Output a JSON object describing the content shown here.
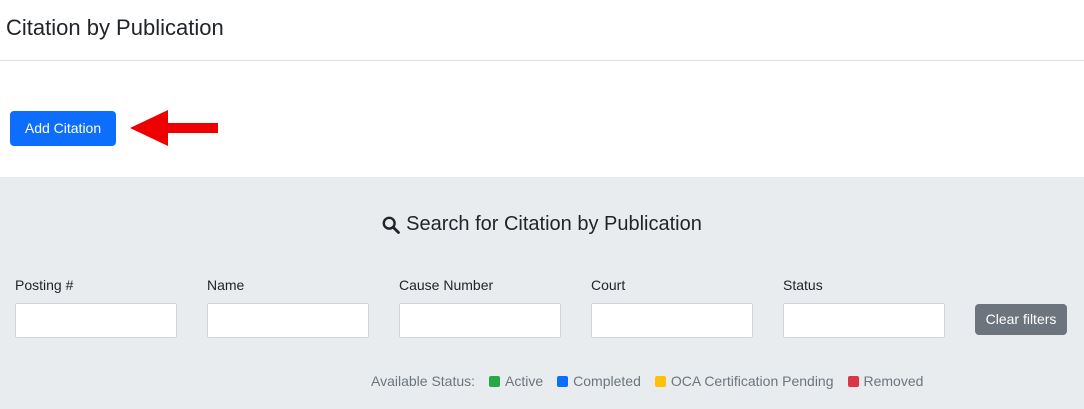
{
  "page": {
    "title": "Citation by Publication"
  },
  "actions": {
    "add_label": "Add Citation"
  },
  "search": {
    "heading": "Search for Citation by Publication",
    "filters": [
      {
        "label": "Posting #",
        "value": ""
      },
      {
        "label": "Name",
        "value": ""
      },
      {
        "label": "Cause Number",
        "value": ""
      },
      {
        "label": "Court",
        "value": ""
      },
      {
        "label": "Status",
        "value": ""
      }
    ],
    "clear_label": "Clear filters"
  },
  "legend": {
    "label": "Available Status:",
    "items": [
      {
        "label": "Active",
        "color": "#28a745"
      },
      {
        "label": "Completed",
        "color": "#0d6efd"
      },
      {
        "label": "OCA Certification Pending",
        "color": "#ffc107"
      },
      {
        "label": "Removed",
        "color": "#dc3545"
      }
    ]
  },
  "colors": {
    "primary": "#0d6efd",
    "secondary": "#6c757d",
    "panel_bg": "#e9ecef",
    "annotation_arrow": "#ee0000"
  },
  "icons": {
    "search": "search-icon",
    "arrow": "arrow-left-icon"
  }
}
